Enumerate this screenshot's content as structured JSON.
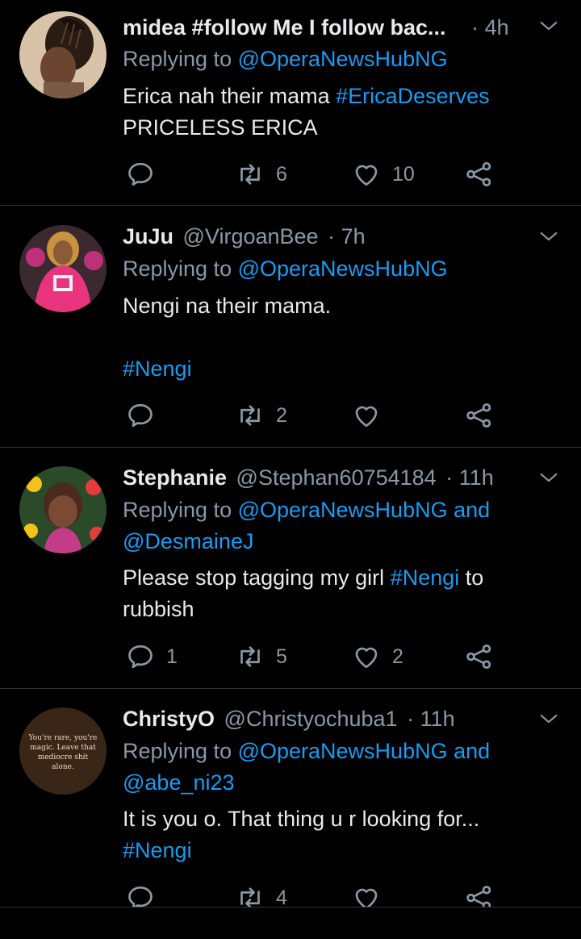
{
  "tweets": [
    {
      "name": "midea #follow Me I follow bac...",
      "handle": "",
      "time": "· 4h",
      "replying_prefix": "Replying to ",
      "replying_to": "@OperaNewsHubNG",
      "replying_suffix": "",
      "replying_to2": "",
      "body_line1_text": "Erica nah their mama ",
      "body_line1_link": "#EricaDeserves",
      "body_line2": "PRICELESS ERICA",
      "replies": "",
      "retweets": "6",
      "likes": "10"
    },
    {
      "name": "JuJu",
      "handle": "@VirgoanBee",
      "time": "· 7h",
      "replying_prefix": "Replying to ",
      "replying_to": "@OperaNewsHubNG",
      "body_line1_text": "Nengi na their mama.",
      "hashtag": "#Nengi",
      "replies": "",
      "retweets": "2",
      "likes": ""
    },
    {
      "name": "Stephanie",
      "handle": "@Stephan60754184",
      "time": "· 11h",
      "replying_prefix": "Replying to ",
      "replying_to": "@OperaNewsHubNG",
      "replying_and": " and",
      "replying_to2": "@DesmaineJ",
      "body_line1_text": "Please stop tagging my girl ",
      "body_line1_link": "#Nengi",
      "body_line1_after": " to",
      "body_line2": "rubbish",
      "replies": "1",
      "retweets": "5",
      "likes": "2"
    },
    {
      "name": "ChristyO",
      "handle": "@Christyochuba1",
      "time": "· 11h",
      "replying_prefix": "Replying to ",
      "replying_to": "@OperaNewsHubNG",
      "replying_and": " and",
      "replying_to2": "@abe_ni23",
      "body_line1_text": "It is you o. That thing u r looking for...",
      "hashtag": "#Nengi",
      "avatar_quote": "You're rare, you're magic. Leave that mediocre shit alone.",
      "replies": "",
      "retweets": "4",
      "likes": ""
    }
  ],
  "icons": {
    "reply": "reply-icon",
    "retweet": "retweet-icon",
    "like": "heart-icon",
    "share": "share-icon",
    "caret": "chevron-down-icon"
  },
  "colors": {
    "background": "#000000",
    "link": "#1d9bf0",
    "muted": "#8b98a5",
    "text": "#e7e9ea"
  }
}
